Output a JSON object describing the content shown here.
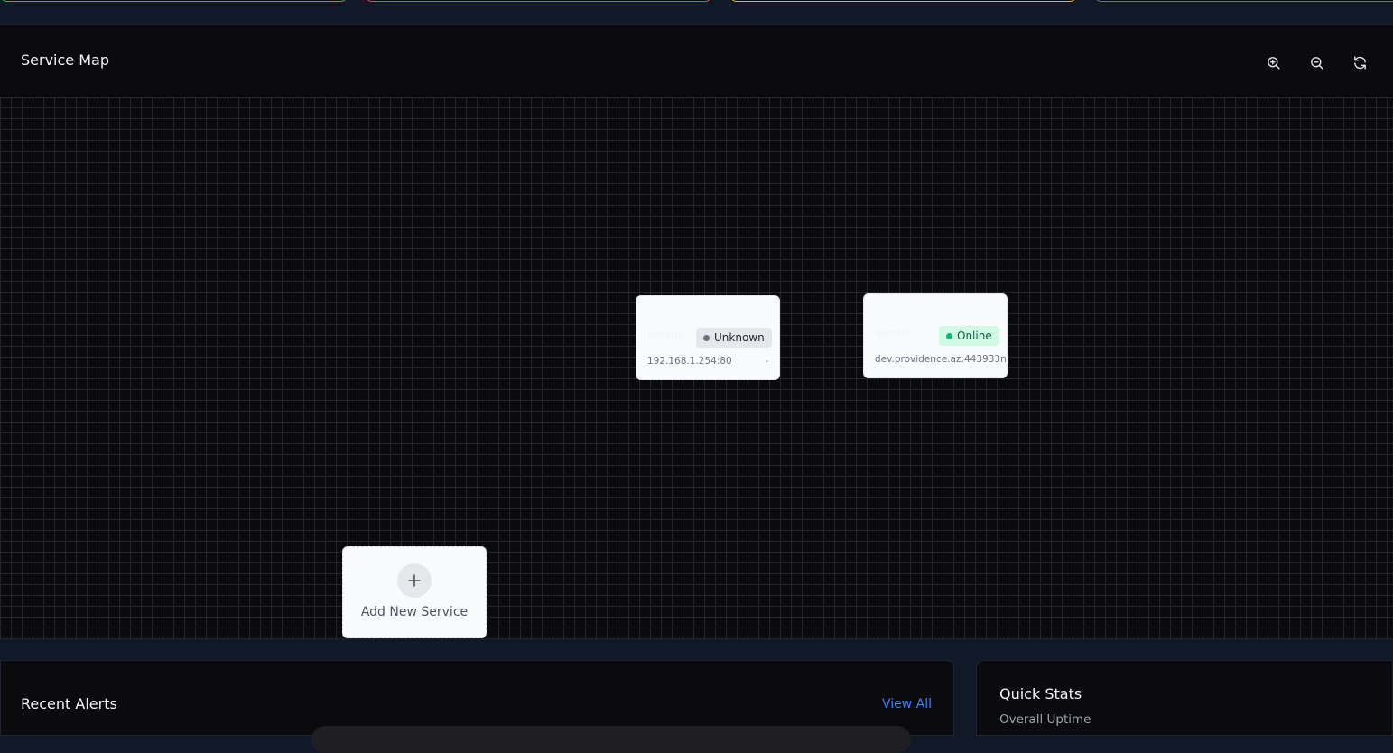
{
  "colors": {
    "card_green": "#22c55e",
    "card_red": "#ef4444",
    "card_yellow": "#eab308",
    "card_blue": "#6366f1",
    "link_blue": "#3b82f6"
  },
  "service_map": {
    "title": "Service Map",
    "controls": {
      "zoom_in_icon": "zoom-in-icon",
      "zoom_out_icon": "zoom-out-icon",
      "refresh_icon": "refresh-icon"
    },
    "nodes": [
      {
        "name": "default",
        "status": "Unknown",
        "address": "192.168.1.254:80",
        "extra": "-"
      },
      {
        "name": "admin",
        "status": "Online",
        "address": "dev.providence.az:443933n"
      }
    ],
    "add_service": {
      "icon": "plus-icon",
      "label": "Add New Service"
    }
  },
  "recent_alerts": {
    "title": "Recent Alerts",
    "view_all": "View All"
  },
  "quick_stats": {
    "title": "Quick Stats",
    "subtitle": "Overall Uptime"
  }
}
